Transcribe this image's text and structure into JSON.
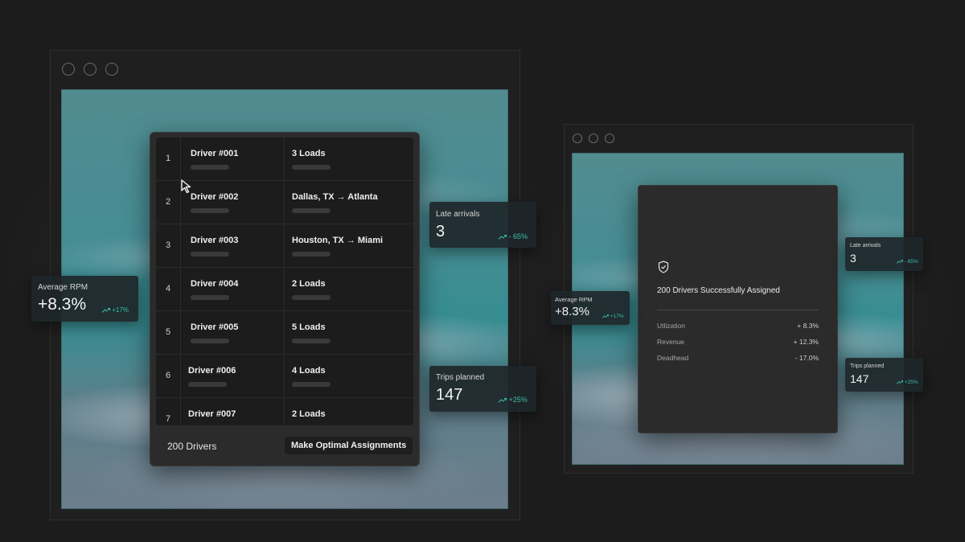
{
  "left_window": {
    "drivers_table": [
      {
        "index": "1",
        "driver": "Driver #001",
        "assignment": "3 Loads"
      },
      {
        "index": "2",
        "driver": "Driver #002",
        "assignment": "Dallas, TX → Atlanta"
      },
      {
        "index": "3",
        "driver": "Driver #003",
        "assignment": "Houston, TX → Miami"
      },
      {
        "index": "4",
        "driver": "Driver #004",
        "assignment": "2 Loads"
      },
      {
        "index": "5",
        "driver": "Driver #005",
        "assignment": "5 Loads"
      },
      {
        "index": "6",
        "driver": "Driver #006",
        "assignment": "4 Loads"
      },
      {
        "index": "7",
        "driver": "Driver #007",
        "assignment": "2 Loads"
      }
    ],
    "driver_count": "200 Drivers",
    "assign_button": "Make Optimal Assignments",
    "cards": {
      "average_rpm": {
        "label": "Average RPM",
        "value": "+8.3%",
        "change": "+17%"
      },
      "late_arrivals": {
        "label": "Late arrivals",
        "value": "3",
        "change": "- 65%"
      },
      "trips_planned": {
        "label": "Trips planned",
        "value": "147",
        "change": "+25%"
      }
    }
  },
  "right_window": {
    "result_title": "200 Drivers Successfully Assigned",
    "metrics": [
      {
        "label": "Utlization",
        "value": "+ 8.3%"
      },
      {
        "label": "Revenue",
        "value": "+ 12.3%"
      },
      {
        "label": "Deadhead",
        "value": "- 17.0%"
      }
    ],
    "cards": {
      "average_rpm": {
        "label": "Average RPM",
        "value": "+8.3%",
        "change": "+17%"
      },
      "late_arrivals": {
        "label": "Late arrivals",
        "value": "3",
        "change": "- 65%"
      },
      "trips_planned": {
        "label": "Trips planned",
        "value": "147",
        "change": "+25%"
      }
    }
  },
  "colors": {
    "background": "#1c1c1d",
    "panel": "#2b2b2c",
    "accent_green": "#3dbfa6",
    "sky_teal": "#3f8f95"
  },
  "icons": [
    "trend-up-icon",
    "shield-check-icon",
    "cursor-arrow-icon",
    "window-dot-icon"
  ]
}
